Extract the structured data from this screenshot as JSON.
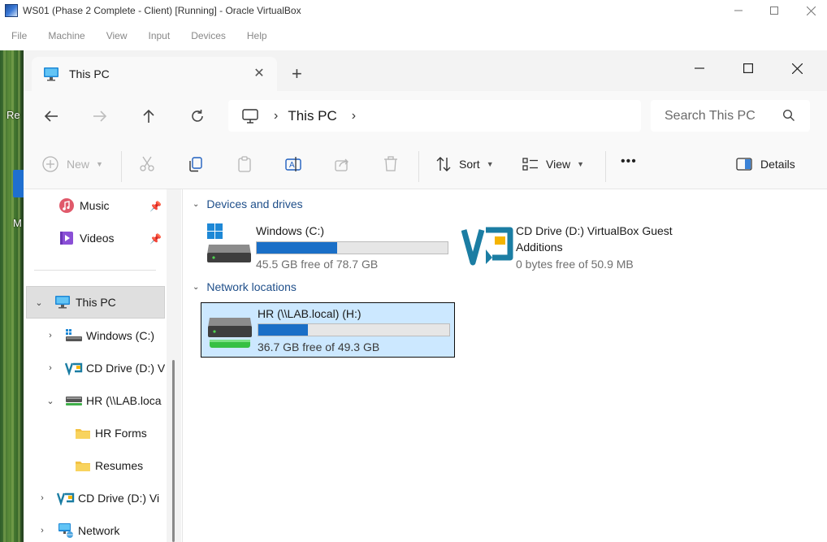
{
  "vbox": {
    "title": "WS01 (Phase 2 Complete - Client) [Running] - Oracle VirtualBox",
    "menu": [
      "File",
      "Machine",
      "View",
      "Input",
      "Devices",
      "Help"
    ]
  },
  "desktop": {
    "label_1": "Re",
    "label_2": "M"
  },
  "explorer": {
    "tab_title": "This PC",
    "address": {
      "segments": [
        "This PC"
      ]
    },
    "search_placeholder": "Search This PC",
    "commands": {
      "new": "New",
      "sort": "Sort",
      "view": "View",
      "more": "•••",
      "details": "Details"
    },
    "nav": {
      "quick_access": [
        {
          "label": "Music",
          "icon": "music-icon"
        },
        {
          "label": "Videos",
          "icon": "videos-icon"
        }
      ],
      "tree": {
        "this_pc": "This PC",
        "windows_c": "Windows (C:)",
        "cd_drive": "CD Drive (D:) V",
        "hr": "HR (\\\\LAB.loca",
        "hr_forms": "HR Forms",
        "resumes": "Resumes",
        "cd_drive_2": "CD Drive (D:) Vi",
        "network": "Network"
      }
    },
    "groups": {
      "devices": "Devices and drives",
      "network": "Network locations"
    },
    "drives": [
      {
        "name": "Windows (C:)",
        "free": "45.5 GB free of 78.7 GB",
        "used_fraction": 0.42
      },
      {
        "name_line1": "CD Drive (D:) VirtualBox Guest",
        "name_line2": "Additions",
        "free": "0 bytes free of 50.9 MB"
      },
      {
        "name": "HR (\\\\LAB.local) (H:)",
        "free": "36.7 GB free of 49.3 GB",
        "used_fraction": 0.26
      }
    ],
    "colors": {
      "accent": "#1a6fc7",
      "selection": "#cce8ff",
      "group_header": "#1f4f8a"
    }
  }
}
